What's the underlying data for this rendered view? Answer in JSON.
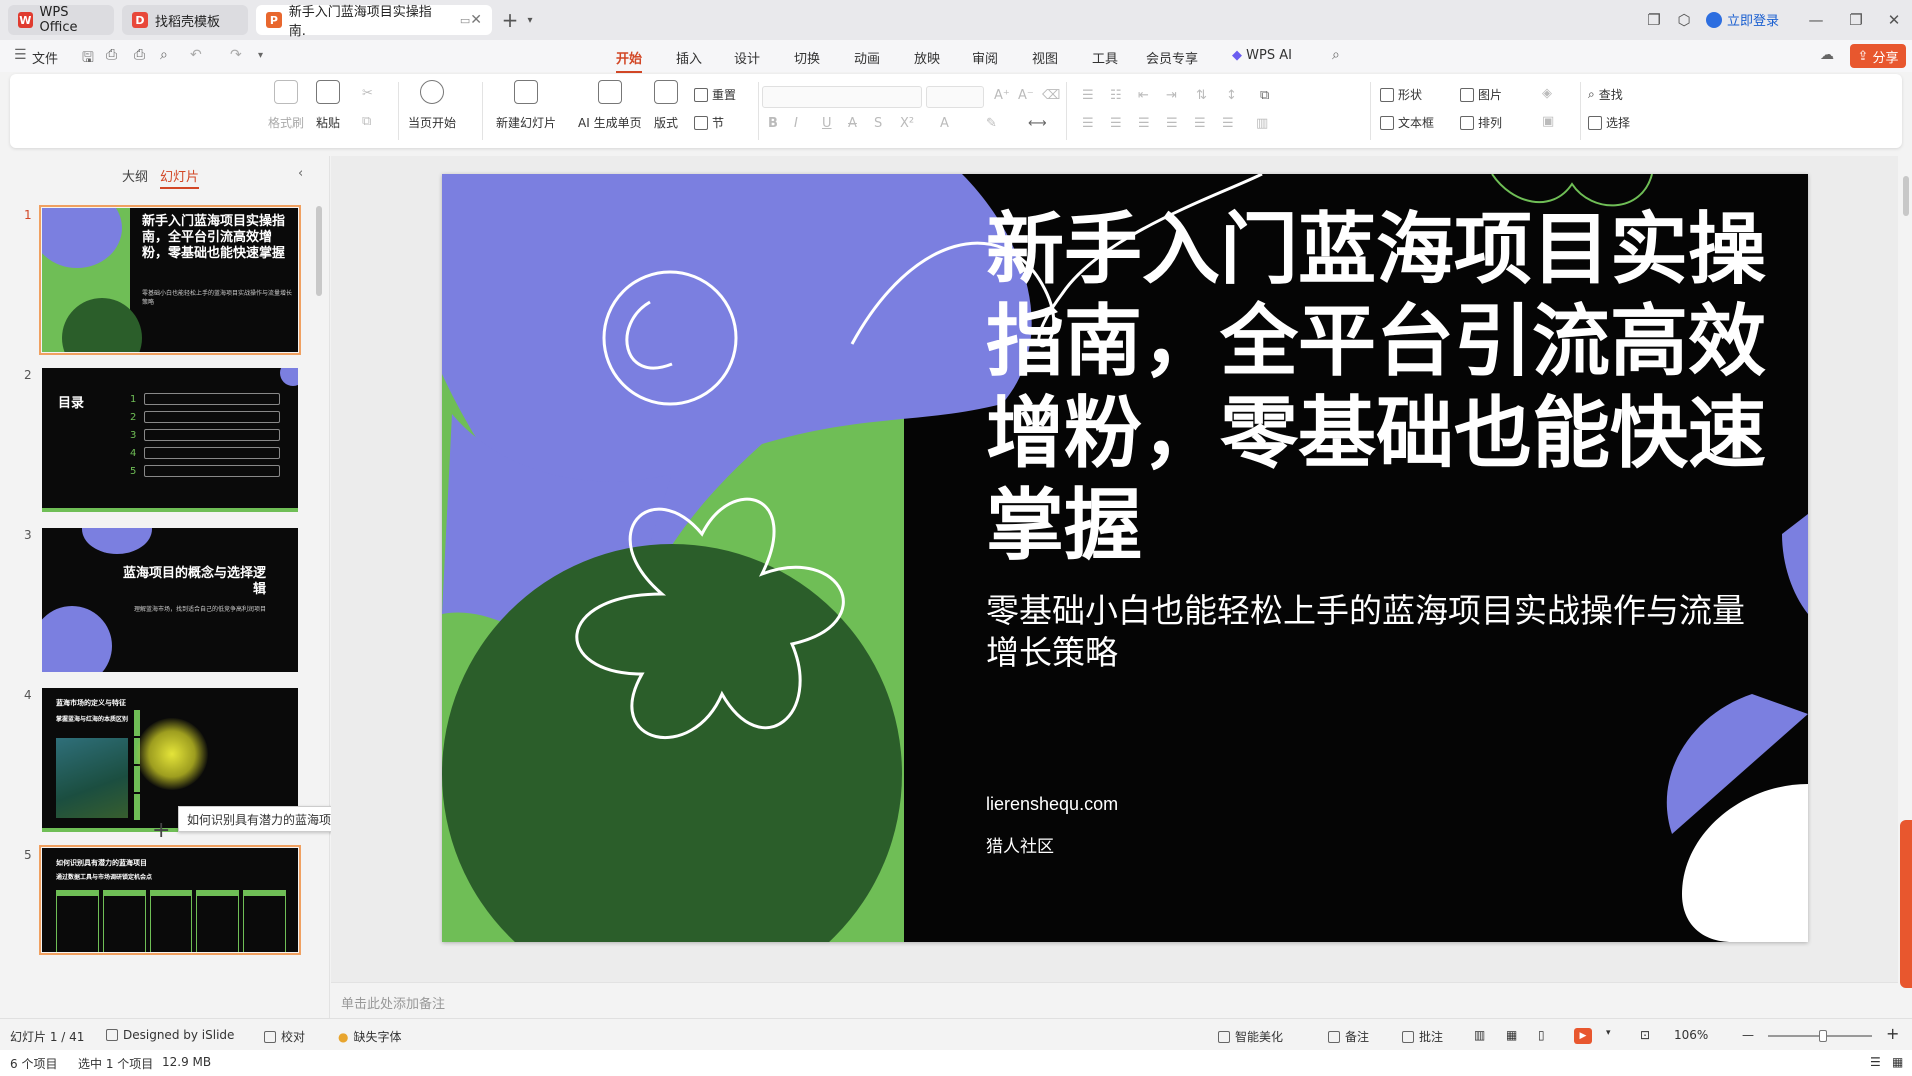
{
  "titlebar": {
    "tabs": [
      {
        "label": "WPS Office",
        "icon": "wps-logo-icon",
        "state": "inactive"
      },
      {
        "label": "找稻壳模板",
        "icon": "docer-icon",
        "state": "inactive"
      },
      {
        "label": "新手入门蓝海项目实操指南.",
        "icon": "presentation-icon",
        "state": "active"
      }
    ],
    "login_label": "立即登录"
  },
  "menu": {
    "file_label": "文件",
    "items": [
      "开始",
      "插入",
      "设计",
      "切换",
      "动画",
      "放映",
      "审阅",
      "视图",
      "工具",
      "会员专享",
      "WPS AI"
    ],
    "active": "开始",
    "share_label": "分享"
  },
  "ribbon": {
    "format_painter": "格式刷",
    "paste": "粘贴",
    "play_from_current": "当页开始",
    "new_slide": "新建幻灯片",
    "ai_generate": "AI 生成单页",
    "layout": "版式",
    "reset": "重置",
    "section": "节",
    "shape": "形状",
    "picture": "图片",
    "textbox": "文本框",
    "arrange": "排列",
    "find": "查找",
    "select": "选择"
  },
  "left_panel": {
    "tabs": [
      "大纲",
      "幻灯片"
    ],
    "active_tab": "幻灯片",
    "slides": [
      {
        "number": "1",
        "title": "新手入门蓝海项目实操指南，全平台引流高效增粉，零基础也能快速掌握",
        "subtitle": "零基础小白也能轻松上手的蓝海项目实战操作与流量增长策略"
      },
      {
        "number": "2",
        "title": "目录",
        "items": [
          "1",
          "2",
          "3",
          "4",
          "5"
        ]
      },
      {
        "number": "3",
        "title": "蓝海项目的概念与选择逻辑",
        "subtitle": "理解蓝海市场，找到适合自己的低竞争高利润项目"
      },
      {
        "number": "4",
        "title": "蓝海市场的定义与特征",
        "subtitle": "掌握蓝海与红海的本质区别"
      },
      {
        "number": "5",
        "title": "如何识别具有潜力的蓝海项目",
        "subtitle": "通过数据工具与市场调研锁定机会点"
      }
    ],
    "tooltip": "如何识别具有潜力的蓝海项目"
  },
  "slide": {
    "title": "新手入门蓝海项目实操指南，全平台引流高效增粉，零基础也能快速掌握",
    "subtitle": "零基础小白也能轻松上手的蓝海项目实战操作与流量增长策略",
    "url": "lierenshequ.com",
    "org": "猎人社区",
    "colors": {
      "green": "#6fbe56",
      "dark_green": "#2b5e2a",
      "purple": "#7b7fe0",
      "black": "#050505"
    }
  },
  "notes": {
    "placeholder": "单击此处添加备注"
  },
  "statusbar": {
    "slide_position": "幻灯片 1 / 41",
    "designer": "Designed by iSlide",
    "proofread": "校对",
    "missing_font": "缺失字体",
    "smart_beautify": "智能美化",
    "notes_label": "备注",
    "comment_label": "批注",
    "zoom": "106%",
    "zoom_fraction": 0.53
  },
  "explorer": {
    "item_count": "6 个项目",
    "selection": "选中 1 个项目",
    "size": "12.9 MB"
  }
}
